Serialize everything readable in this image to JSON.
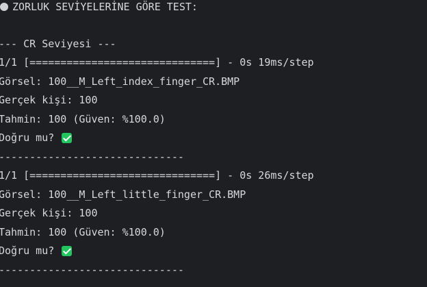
{
  "header": {
    "bullet_icon": "circle-bullet-icon",
    "title": "ZORLUK SEVİYELERİNE GÖRE TEST:"
  },
  "section": {
    "title": "--- CR Seviyesi ---"
  },
  "results": [
    {
      "progress": "1/1 [==============================] - 0s 19ms/step",
      "image_line": "Görsel: 100__M_Left_index_finger_CR.BMP",
      "actual_line": "Gerçek kişi: 100",
      "prediction_line": "Tahmin: 100 (Güven: %100.0)",
      "correct_line": "Doğru mu? ",
      "correct_icon": "check-mark-icon",
      "separator": "------------------------------"
    },
    {
      "progress": "1/1 [==============================] - 0s 26ms/step",
      "image_line": "Görsel: 100__M_Left_little_finger_CR.BMP",
      "actual_line": "Gerçek kişi: 100",
      "prediction_line": "Tahmin: 100 (Güven: %100.0)",
      "correct_line": "Doğru mu? ",
      "correct_icon": "check-mark-icon",
      "separator": "------------------------------"
    }
  ],
  "colors": {
    "background": "#1e1f22",
    "text": "#d6d8dc",
    "check": "#22c55e"
  }
}
